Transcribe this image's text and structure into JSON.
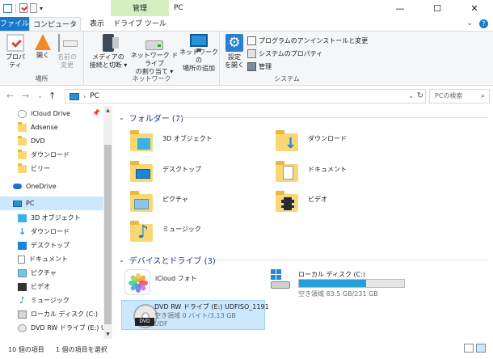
{
  "window": {
    "title": "PC",
    "context_group": "管理",
    "min_glyph": "—",
    "max_glyph": "☐",
    "close_glyph": "✕"
  },
  "tabs": {
    "file": "ファイル",
    "computer": "コンピューター",
    "view": "表示",
    "drive_tools": "ドライブ ツール",
    "collapse_glyph": "⌄",
    "help_glyph": "?"
  },
  "ribbon": {
    "location": {
      "label": "場所",
      "properties": "プロパティ",
      "open": "開く",
      "rename_line1": "名前の",
      "rename_line2": "変更"
    },
    "network": {
      "label": "ネットワーク",
      "media_line1": "メディアの",
      "media_line2": "接続と切断 ▾",
      "mapdrive_line1": "ネットワーク ドライブ",
      "mapdrive_line2": "の割り当て ▾",
      "addloc_line1": "ネットワークの",
      "addloc_line2": "場所の追加"
    },
    "system": {
      "label": "システム",
      "settings_line1": "設定",
      "settings_line2": "を開く",
      "uninstall": "プログラムのアンインストールと変更",
      "sysprops": "システムのプロパティ",
      "manage": "管理"
    }
  },
  "address": {
    "back": "←",
    "forward": "→",
    "recent": "⌄",
    "up": "↑",
    "chevron": "›",
    "path": "PC",
    "dropdown": "⌄",
    "refresh": "↻",
    "search_placeholder": "PCの検索",
    "search_glyph": "⌕"
  },
  "nav": {
    "pin_glyph": "📌",
    "items": [
      {
        "label": "iCloud Drive",
        "icon": "icloud-drive-icon"
      },
      {
        "label": "Adsense",
        "icon": "folder-icon"
      },
      {
        "label": "DVD",
        "icon": "folder-icon"
      },
      {
        "label": "ダウンロード",
        "icon": "folder-icon"
      },
      {
        "label": "ビリー",
        "icon": "folder-icon"
      },
      {
        "label": "OneDrive",
        "icon": "onedrive-icon"
      },
      {
        "label": "PC",
        "icon": "pc-icon"
      },
      {
        "label": "3D オブジェクト",
        "icon": "3d-objects-icon"
      },
      {
        "label": "ダウンロード",
        "icon": "downloads-icon"
      },
      {
        "label": "デスクトップ",
        "icon": "desktop-icon"
      },
      {
        "label": "ドキュメント",
        "icon": "documents-icon"
      },
      {
        "label": "ピクチャ",
        "icon": "pictures-icon"
      },
      {
        "label": "ビデオ",
        "icon": "videos-icon"
      },
      {
        "label": "ミュージック",
        "icon": "music-icon"
      },
      {
        "label": "ローカル ディスク (C:)",
        "icon": "local-disk-icon"
      },
      {
        "label": "DVD RW ドライブ (E:) UDF",
        "icon": "dvd-drive-icon"
      }
    ]
  },
  "content": {
    "chevron": "⌄",
    "folders_header": "フォルダー (7)",
    "folders": [
      {
        "name": "3D オブジェクト",
        "icon": "3d-objects-folder-icon"
      },
      {
        "name": "ダウンロード",
        "icon": "downloads-folder-icon"
      },
      {
        "name": "デスクトップ",
        "icon": "desktop-folder-icon"
      },
      {
        "name": "ドキュメント",
        "icon": "documents-folder-icon"
      },
      {
        "name": "ピクチャ",
        "icon": "pictures-folder-icon"
      },
      {
        "name": "ビデオ",
        "icon": "videos-folder-icon"
      },
      {
        "name": "ミュージック",
        "icon": "music-folder-icon"
      }
    ],
    "devices_header": "デバイスとドライブ (3)",
    "devices": {
      "icloud": {
        "name": "iCloud フォト"
      },
      "local": {
        "name": "ローカル ディスク (C:)",
        "free": "空き領域 83.5 GB/231 GB",
        "used_fraction": 0.64
      },
      "dvd": {
        "name": "DVD RW ドライブ (E:) UDFISO_1191",
        "free": "空き領域 0 バイト/3.13 GB",
        "fs": "UDF",
        "label": "DVD"
      }
    }
  },
  "status": {
    "count": "10 個の項目",
    "selected": "1 個の項目を選択"
  },
  "colors": {
    "accent": "#1979ca",
    "selection": "#cce8ff",
    "header": "#1e3287",
    "drive_bar": "#26a0da"
  }
}
